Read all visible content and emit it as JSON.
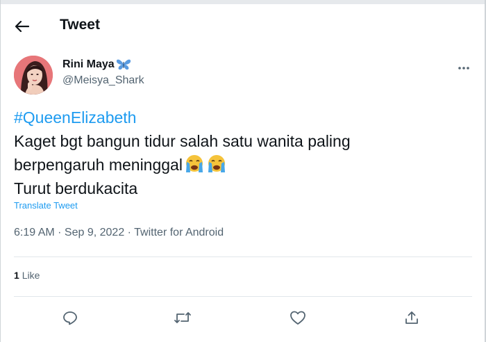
{
  "header": {
    "title": "Tweet"
  },
  "author": {
    "display_name": "Rini Maya",
    "handle": "@Meisya_Shark",
    "name_emoji": "butterfly-icon"
  },
  "tweet": {
    "hashtag": "#QueenElizabeth",
    "line1": "Kaget bgt bangun tidur salah satu wanita paling",
    "line2": "berpengaruh meninggal",
    "line2_emojis": [
      "loudly-crying-face-icon",
      "loudly-crying-face-icon"
    ],
    "line3": "Turut berdukacita"
  },
  "translate_label": "Translate Tweet",
  "meta": {
    "time": "6:19 AM",
    "date": "Sep 9, 2022",
    "source": "Twitter for Android",
    "separator": " · "
  },
  "stats": {
    "likes_count": "1",
    "likes_label": "Like"
  },
  "colors": {
    "link": "#1d9bf0",
    "secondary": "#536471",
    "text": "#0f1419",
    "divider": "#e1e6ea"
  }
}
